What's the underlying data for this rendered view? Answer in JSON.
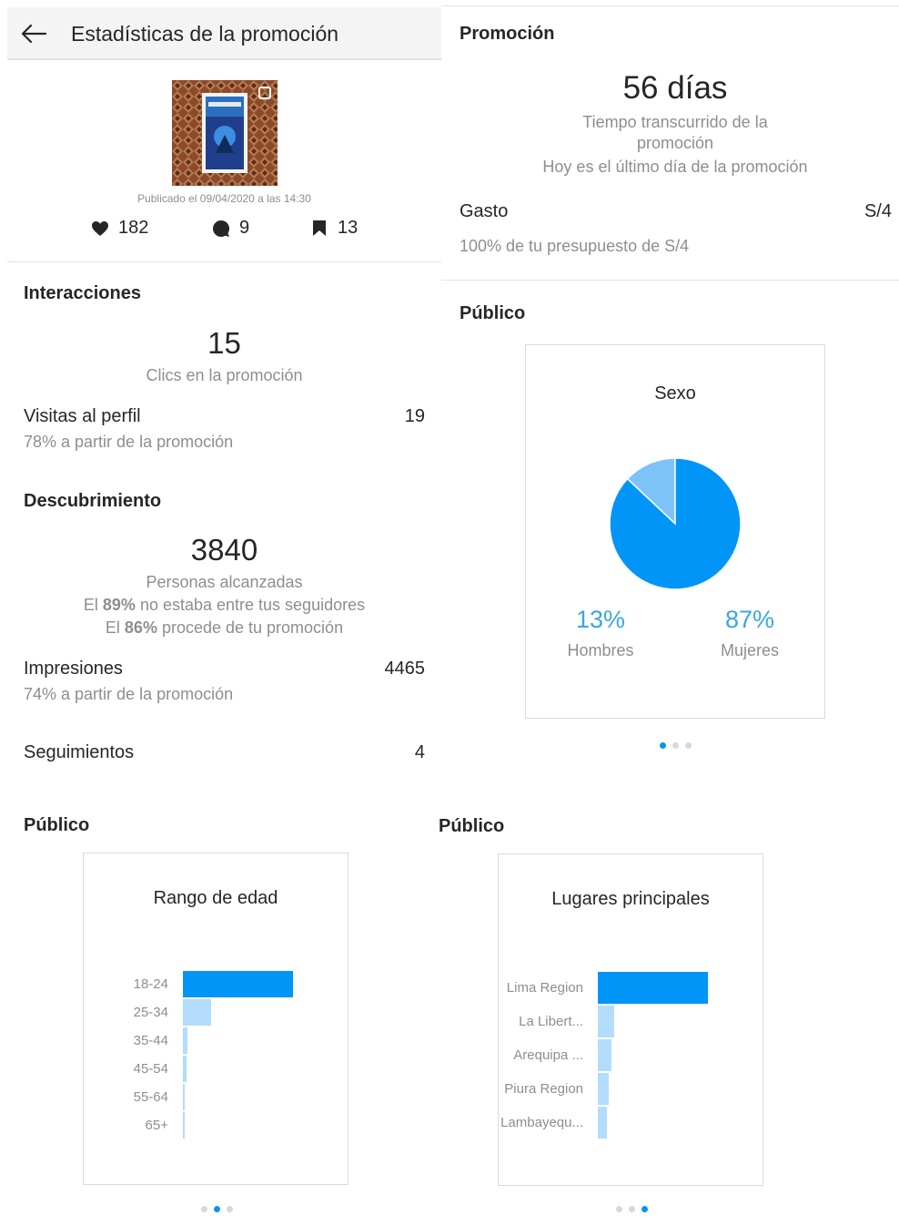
{
  "header": {
    "title": "Estadísticas de la promoción"
  },
  "post": {
    "published": "Publicado el 09/04/2020 a las 14:30",
    "likes": "182",
    "comments": "9",
    "saves": "13"
  },
  "interactions": {
    "title": "Interacciones",
    "clicks": "15",
    "clicks_label": "Clics en la promoción",
    "profile_visits_label": "Visitas al perfil",
    "profile_visits_value": "19",
    "profile_visits_sub": "78% a partir de la promoción"
  },
  "discovery": {
    "title": "Descubrimiento",
    "reach": "3840",
    "reach_label": "Personas alcanzadas",
    "line1_pre": "El ",
    "line1_bold": "89%",
    "line1_post": " no estaba entre tus seguidores",
    "line2_pre": "El ",
    "line2_bold": "86%",
    "line2_post": " procede de tu promoción",
    "impressions_label": "Impresiones",
    "impressions_value": "4465",
    "impressions_sub": "74% a partir de la promoción",
    "follows_label": "Seguimientos",
    "follows_value": "4"
  },
  "promotion": {
    "title": "Promoción",
    "days": "56 días",
    "elapsed_line1": "Tiempo transcurrido de la",
    "elapsed_line2": "promoción",
    "last_day": "Hoy es el último día de la promoción",
    "spend_label": "Gasto",
    "spend_value": "S/4",
    "spend_sub": "100% de tu presupuesto de S/4"
  },
  "audience_titles": {
    "top_right": "Público",
    "bottom_left": "Público",
    "bottom_right": "Público"
  },
  "colors": {
    "primary_blue": "#0095f6",
    "light_blue": "#b3dcfd",
    "pct_blue": "#3aa7dd"
  },
  "chart_data": [
    {
      "type": "pie",
      "title": "Sexo",
      "categories": [
        "Hombres",
        "Mujeres"
      ],
      "values": [
        13,
        87
      ],
      "labels": [
        "13%",
        "87%"
      ],
      "active_page": 1,
      "pages": 3
    },
    {
      "type": "bar",
      "orientation": "horizontal",
      "title": "Rango de edad",
      "categories": [
        "18-24",
        "25-34",
        "35-44",
        "45-54",
        "55-64",
        "65+"
      ],
      "values": [
        100,
        26,
        4,
        3,
        2,
        1.5
      ],
      "active_page": 2,
      "pages": 3
    },
    {
      "type": "bar",
      "orientation": "horizontal",
      "title": "Lugares principales",
      "categories": [
        "Lima Region",
        "La Libert...",
        "Arequipa ...",
        "Piura Region",
        "Lambayequ..."
      ],
      "values": [
        100,
        15,
        12,
        10,
        8
      ],
      "active_page": 3,
      "pages": 3
    }
  ]
}
